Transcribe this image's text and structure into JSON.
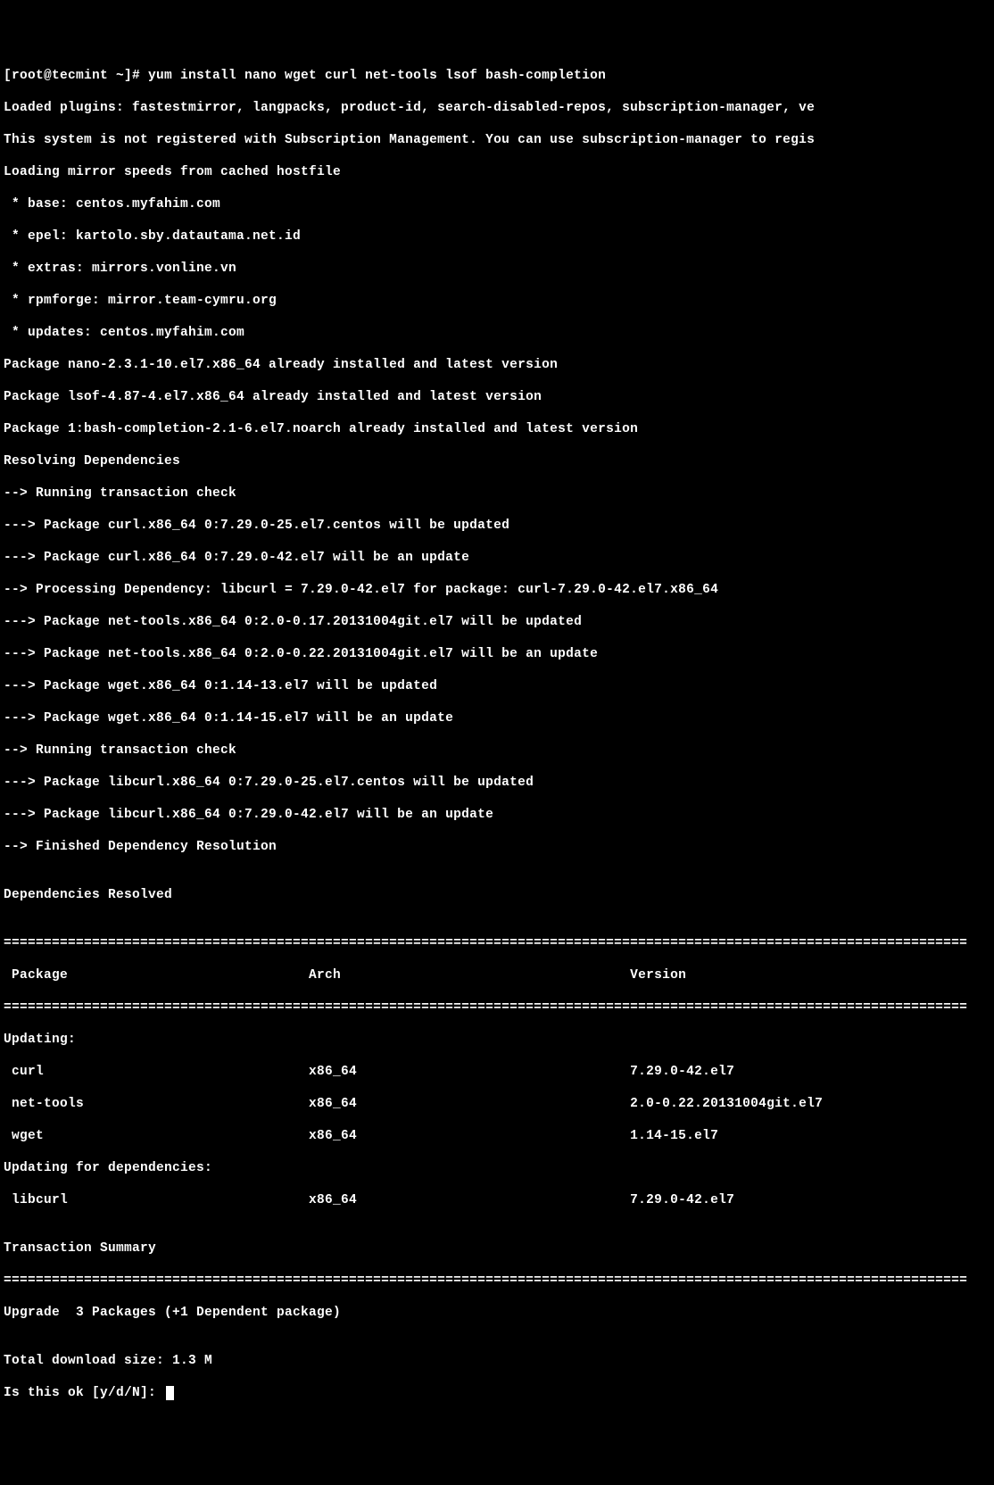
{
  "prompt": "[root@tecmint ~]# ",
  "command": "yum install nano wget curl net-tools lsof bash-completion",
  "lines": {
    "l1": "Loaded plugins: fastestmirror, langpacks, product-id, search-disabled-repos, subscription-manager, ve",
    "l2": "This system is not registered with Subscription Management. You can use subscription-manager to regis",
    "l3": "Loading mirror speeds from cached hostfile",
    "l4": " * base: centos.myfahim.com",
    "l5": " * epel: kartolo.sby.datautama.net.id",
    "l6": " * extras: mirrors.vonline.vn",
    "l7": " * rpmforge: mirror.team-cymru.org",
    "l8": " * updates: centos.myfahim.com",
    "l9": "Package nano-2.3.1-10.el7.x86_64 already installed and latest version",
    "l10": "Package lsof-4.87-4.el7.x86_64 already installed and latest version",
    "l11": "Package 1:bash-completion-2.1-6.el7.noarch already installed and latest version",
    "l12": "Resolving Dependencies",
    "l13": "--> Running transaction check",
    "l14": "---> Package curl.x86_64 0:7.29.0-25.el7.centos will be updated",
    "l15": "---> Package curl.x86_64 0:7.29.0-42.el7 will be an update",
    "l16": "--> Processing Dependency: libcurl = 7.29.0-42.el7 for package: curl-7.29.0-42.el7.x86_64",
    "l17": "---> Package net-tools.x86_64 0:2.0-0.17.20131004git.el7 will be updated",
    "l18": "---> Package net-tools.x86_64 0:2.0-0.22.20131004git.el7 will be an update",
    "l19": "---> Package wget.x86_64 0:1.14-13.el7 will be updated",
    "l20": "---> Package wget.x86_64 0:1.14-15.el7 will be an update",
    "l21": "--> Running transaction check",
    "l22": "---> Package libcurl.x86_64 0:7.29.0-25.el7.centos will be updated",
    "l23": "---> Package libcurl.x86_64 0:7.29.0-42.el7 will be an update",
    "l24": "--> Finished Dependency Resolution",
    "l25": "",
    "l26": "Dependencies Resolved",
    "l27": ""
  },
  "divider": "========================================================================================================================",
  "table": {
    "header": " Package                              Arch                                    Version",
    "updating_label": "Updating:",
    "rows": [
      " curl                                 x86_64                                  7.29.0-42.el7",
      " net-tools                            x86_64                                  2.0-0.22.20131004git.el7",
      " wget                                 x86_64                                  1.14-15.el7"
    ],
    "updating_deps_label": "Updating for dependencies:",
    "dep_rows": [
      " libcurl                              x86_64                                  7.29.0-42.el7"
    ]
  },
  "footer": {
    "blank": "",
    "summary_label": "Transaction Summary",
    "upgrade_line": "Upgrade  3 Packages (+1 Dependent package)",
    "blank2": "",
    "download_size": "Total download size: 1.3 M",
    "prompt_confirm": "Is this ok [y/d/N]: "
  }
}
